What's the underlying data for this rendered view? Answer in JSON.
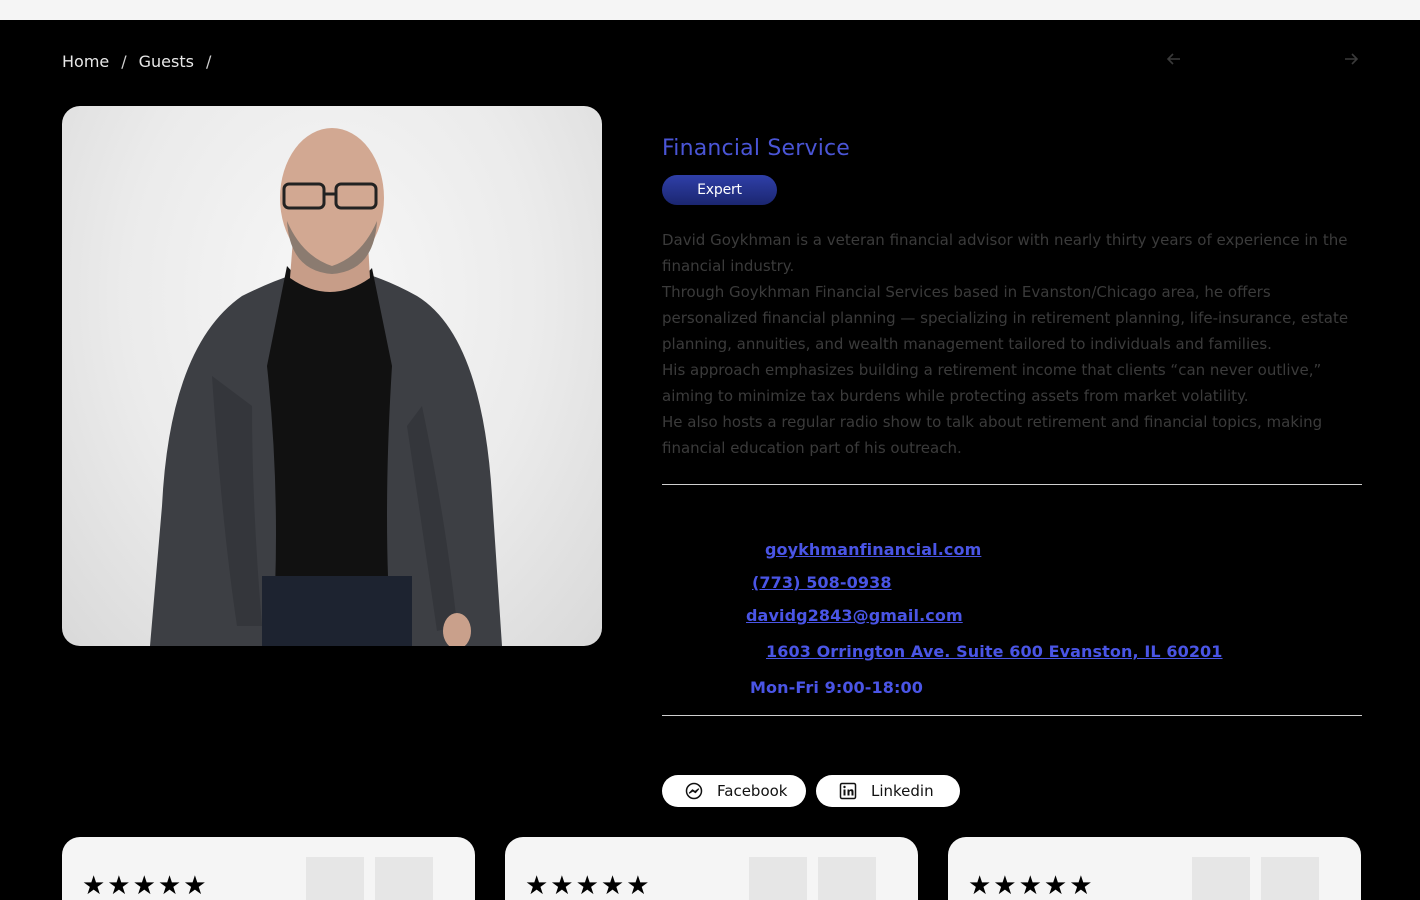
{
  "breadcrumb": {
    "home": "Home",
    "guests": "Guests",
    "separator": "/"
  },
  "nav": {
    "prev_icon": "arrow-left-icon",
    "next_icon": "arrow-right-icon"
  },
  "profile": {
    "title": "Financial Service",
    "badge": "Expert",
    "bio": [
      "David Goykhman is a veteran financial advisor with nearly thirty years of experience in the financial industry.",
      "Through Goykhman Financial Services based in Evanston/Chicago area, he offers personalized financial planning — specializing in retirement planning, life-insurance, estate planning, annuities, and wealth management tailored to individuals and families.",
      "His approach emphasizes building a retirement income that clients “can never outlive,” aiming to minimize tax burdens while protecting assets from market volatility.",
      "He also hosts a regular radio show to talk about retirement and financial topics, making financial education part of his outreach."
    ]
  },
  "contact": {
    "website": "goykhmanfinancial.com",
    "phone": "(773) 508-0938",
    "email": "davidg2843@gmail.com",
    "address": "1603 Orrington Ave. Suite 600 Evanston, IL 60201",
    "hours": "Mon-Fri 9:00-18:00"
  },
  "social": {
    "facebook": "Facebook",
    "linkedin": "Linkedin"
  },
  "reviews": [
    {
      "stars": "★★★★★",
      "rating": 5
    },
    {
      "stars": "★★★★★",
      "rating": 5
    },
    {
      "stars": "★★★★★",
      "rating": 5
    }
  ],
  "colors": {
    "accent": "#4a55e6",
    "badge": "#1f2b80",
    "background": "#000000"
  }
}
